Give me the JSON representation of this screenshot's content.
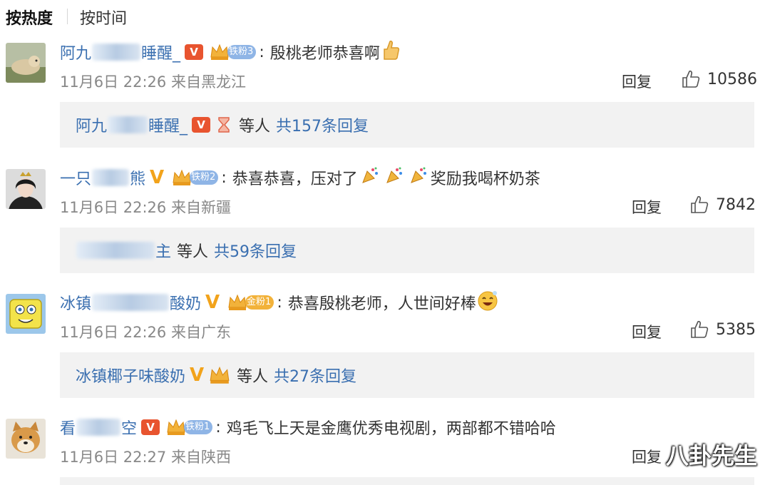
{
  "tabs": {
    "hot": "按热度",
    "time": "按时间"
  },
  "comments": [
    {
      "name_start": "阿九",
      "name_end": "睡醒_",
      "fan_label": "铁粉3",
      "text": "殷桃老师恭喜啊",
      "time": "11月6日 22:26 来自黑龙江",
      "reply": "回复",
      "likes": "10586",
      "replybox": {
        "name_start": "阿九",
        "name_end": "睡醒_",
        "etc": "等人",
        "total": "共157条回复"
      }
    },
    {
      "name_start": "一只",
      "name_end": "熊",
      "fan_label": "铁粉2",
      "text": "恭喜恭喜，压对了",
      "text_after": "奖励我喝杯奶茶",
      "time": "11月6日 22:26 来自新疆",
      "reply": "回复",
      "likes": "7842",
      "replybox": {
        "name_end": "主",
        "etc": "等人",
        "total": "共59条回复"
      }
    },
    {
      "name_start": "冰镇",
      "name_end": "酸奶",
      "fan_label": "金粉1",
      "text": "恭喜殷桃老师，人世间好棒",
      "time": "11月6日 22:26 来自广东",
      "reply": "回复",
      "likes": "5385",
      "replybox": {
        "name": "冰镇椰子味酸奶",
        "etc": "等人",
        "total": "共27条回复"
      }
    },
    {
      "name_start": "看",
      "name_end": "空",
      "fan_label": "铁粉1",
      "text": "鸡毛飞上天是金鹰优秀电视剧，两部都不错哈哈",
      "time": "11月6日 22:27 来自陕西",
      "reply": "回复"
    }
  ],
  "watermark": "八卦先生",
  "colors": {
    "link": "#3a6fb0",
    "meta": "#888888",
    "reply_bg": "#f2f2f2",
    "v_badge": "#e8542f",
    "v_gold": "#f2a31b"
  }
}
